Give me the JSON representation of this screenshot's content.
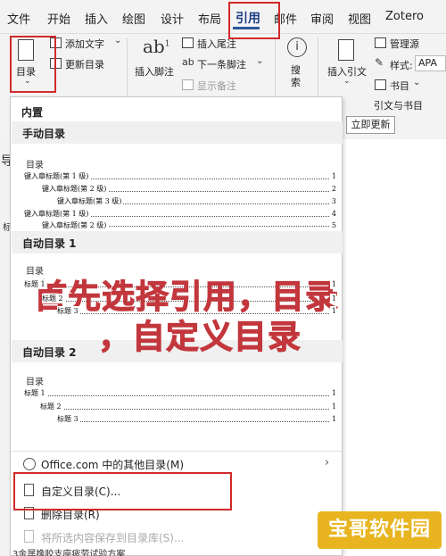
{
  "menubar": {
    "tabs": [
      "文件",
      "开始",
      "插入",
      "绘图",
      "设计",
      "布局",
      "引用",
      "邮件",
      "审阅",
      "视图",
      "Zotero"
    ],
    "active": "引用"
  },
  "ribbon": {
    "toc_button": "目录",
    "add_text": "添加文字",
    "update_toc": "更新目录",
    "insert_footnote": "插入脚注",
    "insert_endnote": "插入尾注",
    "next_footnote": "下一条脚注",
    "show_notes": "显示备注",
    "search": "搜索",
    "insert_citation": "插入引文",
    "manage_sources": "管理源",
    "style_label": "样式:",
    "style_value": "APA",
    "bibliography": "书目",
    "group_citations": "引文与书目",
    "update_now": "立即更新"
  },
  "dropdown": {
    "section_builtin": "内置",
    "manual_toc": {
      "heading": "手动目录",
      "title": "目录",
      "lines": [
        {
          "text": "键入章标题(第 1 级)",
          "page": "1"
        },
        {
          "text": "键入章标题(第 2 级)",
          "page": "2"
        },
        {
          "text": "键入章标题(第 3 级)",
          "page": "3"
        },
        {
          "text": "键入章标题(第 1 级)",
          "page": "4"
        },
        {
          "text": "键入章标题(第 2 级)",
          "page": "5"
        }
      ]
    },
    "auto_toc_1": {
      "heading": "自动目录 1",
      "title": "目录",
      "lines": [
        {
          "text": "标题 1",
          "page": "1"
        },
        {
          "text": "标题 2",
          "page": "1"
        },
        {
          "text": "标题 3",
          "page": "1"
        }
      ]
    },
    "auto_toc_2": {
      "heading": "自动目录 2",
      "title": "目录",
      "lines": [
        {
          "text": "标题 1",
          "page": "1"
        },
        {
          "text": "标题 2",
          "page": "1"
        },
        {
          "text": "标题 3",
          "page": "1"
        }
      ]
    },
    "more_toc": "Office.com 中的其他目录(M)",
    "custom_toc": "自定义目录(C)...",
    "remove_toc": "删除目录(R)",
    "save_selection": "将所选内容保存到目录库(S)..."
  },
  "overlay": {
    "line1": "首先选择引用，目录",
    "line2": "，自定义目录"
  },
  "watermark": "宝哥软件园",
  "status_text": "3金属橡胶支座疲劳试验方案",
  "colors": {
    "highlight": "#d12a2a",
    "overlay_text": "#c2373d",
    "watermark_bg": "#e8b521"
  }
}
